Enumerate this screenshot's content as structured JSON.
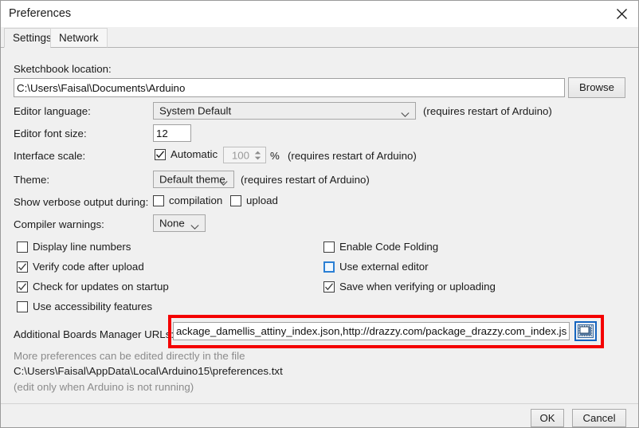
{
  "window": {
    "title": "Preferences",
    "close_icon": "close-icon"
  },
  "tabs": [
    {
      "label": "Settings",
      "active": true
    },
    {
      "label": "Network",
      "active": false
    }
  ],
  "settings": {
    "sketchbook": {
      "label": "Sketchbook location:",
      "value": "C:\\Users\\Faisal\\Documents\\Arduino",
      "placeholder": "",
      "browse_label": "Browse"
    },
    "editor_language": {
      "label": "Editor language:",
      "value": "System Default",
      "note": "(requires restart of Arduino)"
    },
    "editor_font_size": {
      "label": "Editor font size:",
      "value": "12"
    },
    "interface_scale": {
      "label": "Interface scale:",
      "automatic_label": "Automatic",
      "automatic_checked": true,
      "scale_value": "100",
      "percent_label": "%",
      "note": "(requires restart of Arduino)"
    },
    "theme": {
      "label": "Theme:",
      "value": "Default theme",
      "note": "(requires restart of Arduino)"
    },
    "verbose": {
      "label": "Show verbose output during:",
      "compilation_label": "compilation",
      "compilation_checked": false,
      "upload_label": "upload",
      "upload_checked": false
    },
    "compiler_warnings": {
      "label": "Compiler warnings:",
      "value": "None"
    },
    "checkboxes_left": [
      {
        "label": "Display line numbers",
        "checked": false,
        "highlighted": false
      },
      {
        "label": "Verify code after upload",
        "checked": true,
        "highlighted": false
      },
      {
        "label": "Check for updates on startup",
        "checked": true,
        "highlighted": false
      },
      {
        "label": "Use accessibility features",
        "checked": false,
        "highlighted": false
      }
    ],
    "checkboxes_right": [
      {
        "label": "Enable Code Folding",
        "checked": false,
        "highlighted": false
      },
      {
        "label": "Use external editor",
        "checked": false,
        "highlighted": true
      },
      {
        "label": "Save when verifying or uploading",
        "checked": true,
        "highlighted": false
      }
    ],
    "boards_urls": {
      "label": "Additional Boards Manager URLs:",
      "value": "ackage_damellis_attiny_index.json,http://drazzy.com/package_drazzy.com_index.json",
      "placeholder": "",
      "edit_button_icon": "window-edit-icon",
      "highlight_color": "#f40000"
    },
    "hints": {
      "line1": "More preferences can be edited directly in the file",
      "line2": "C:\\Users\\Faisal\\AppData\\Local\\Arduino15\\preferences.txt",
      "line3": "(edit only when Arduino is not running)"
    }
  },
  "footer": {
    "ok_label": "OK",
    "cancel_label": "Cancel"
  }
}
